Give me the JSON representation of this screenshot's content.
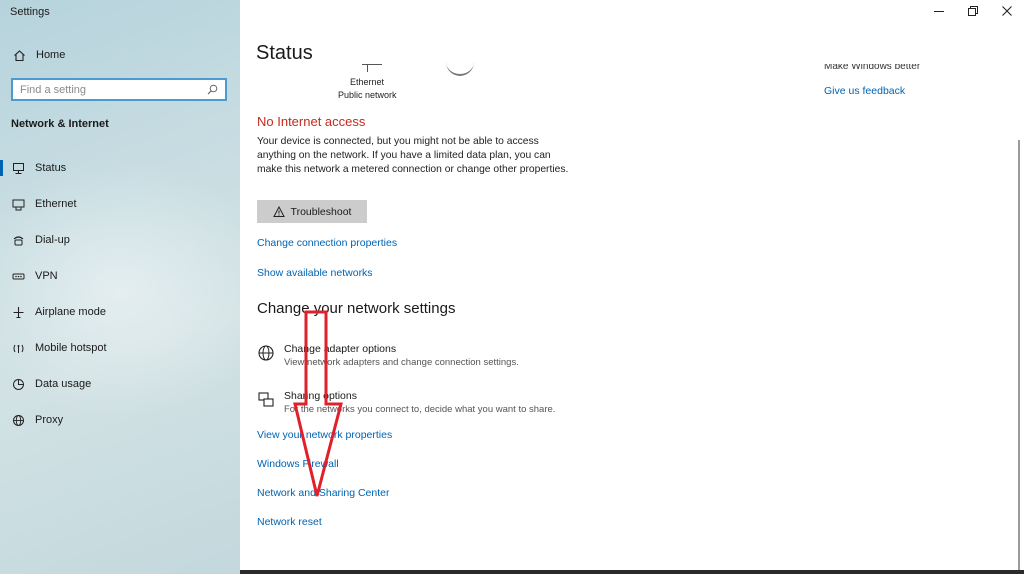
{
  "window": {
    "title": "Settings",
    "controls": [
      "minimize-icon",
      "restore-icon",
      "close-icon"
    ]
  },
  "sidebar": {
    "home_label": "Home",
    "search_placeholder": "Find a setting",
    "section_heading": "Network & Internet",
    "items": [
      {
        "label": "Status",
        "icon": "status-icon",
        "active": true
      },
      {
        "label": "Ethernet",
        "icon": "ethernet-icon"
      },
      {
        "label": "Dial-up",
        "icon": "dial-up-icon"
      },
      {
        "label": "VPN",
        "icon": "vpn-icon"
      },
      {
        "label": "Airplane mode",
        "icon": "airplane-icon"
      },
      {
        "label": "Mobile hotspot",
        "icon": "hotspot-icon"
      },
      {
        "label": "Data usage",
        "icon": "data-usage-icon"
      },
      {
        "label": "Proxy",
        "icon": "globe-icon"
      }
    ]
  },
  "main": {
    "page_title": "Status",
    "connection": {
      "name": "Ethernet",
      "network_type": "Public network"
    },
    "side_panel": {
      "partial_heading": "Make Windows better",
      "feedback_link": "Give us feedback"
    },
    "status_heading": "No Internet access",
    "status_description": "Your device is connected, but you might not be able to access anything on the network. If you have a limited data plan, you can make this network a metered connection or change other properties.",
    "troubleshoot_label": "Troubleshoot",
    "links_top": [
      "Change connection properties",
      "Show available networks"
    ],
    "change_settings_heading": "Change your network settings",
    "options": [
      {
        "title": "Change adapter options",
        "desc": "View network adapters and change connection settings.",
        "icon": "adapter-icon"
      },
      {
        "title": "Sharing options",
        "desc": "For the networks you connect to, decide what you want to share.",
        "icon": "sharing-icon"
      }
    ],
    "links_bottom": [
      "View your network properties",
      "Windows Firewall",
      "Network and Sharing Center",
      "Network reset"
    ]
  },
  "colors": {
    "accent": "#0063b1",
    "error": "#c42b1c",
    "annotation_arrow": "#e0202a"
  }
}
